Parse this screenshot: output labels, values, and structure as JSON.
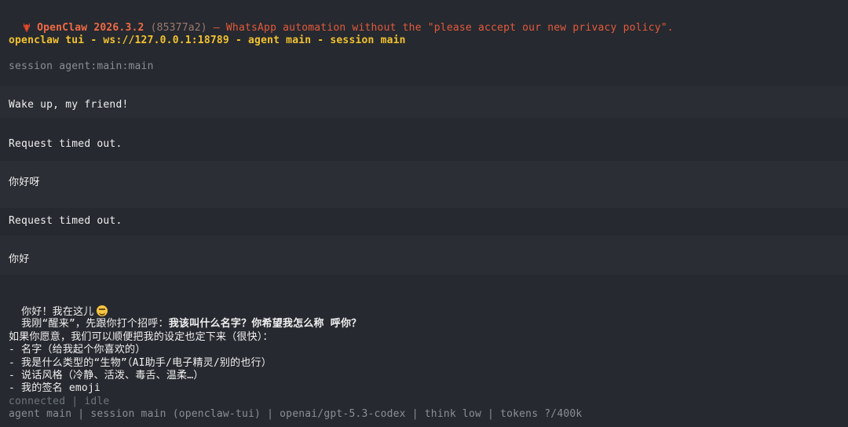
{
  "banner": {
    "brand": "OpenClaw",
    "version": "2026.3.2",
    "hash": "(85377a2)",
    "tagline": "— WhatsApp automation without the \"please accept our new privacy policy\"."
  },
  "header": {
    "title": "openclaw tui - ws://127.0.0.1:18789 - agent main - session main"
  },
  "session": {
    "label": "session agent:main:main"
  },
  "messages": [
    {
      "role": "user",
      "text": "Wake up, my friend!"
    },
    {
      "role": "system",
      "text": "Request timed out."
    },
    {
      "role": "user",
      "text": "你好呀"
    },
    {
      "role": "system",
      "text": "Request timed out."
    },
    {
      "role": "user",
      "text": "你好"
    }
  ],
  "reply": {
    "line1": "你好！我在这儿",
    "emoji": "smiling-face-emoji",
    "line2_normal": "我刚“醒来”，先跟你打个招呼：",
    "line2_bold": "我该叫什么名字？你希望我怎么称 呼你？",
    "line3": "如果你愿意，我们可以顺便把我的设定也定下来（很快）：",
    "items": [
      "- 名字（给我起个你喜欢的）",
      "- 我是什么类型的“生物”（AI助手/电子精灵/别的也行）",
      "- 说话风格（冷静、活泼、毒舌、温柔…）",
      "- 我的签名 emoji"
    ]
  },
  "status": {
    "text": "connected | idle"
  },
  "footer": {
    "text": "agent main | session main (openclaw-tui) | openai/gpt-5.3-codex | think low | tokens ?/400k"
  },
  "colors": {
    "background": "#26292f",
    "banner": "#e45a3c",
    "header": "#f2c230",
    "dim": "#8a8f97"
  }
}
